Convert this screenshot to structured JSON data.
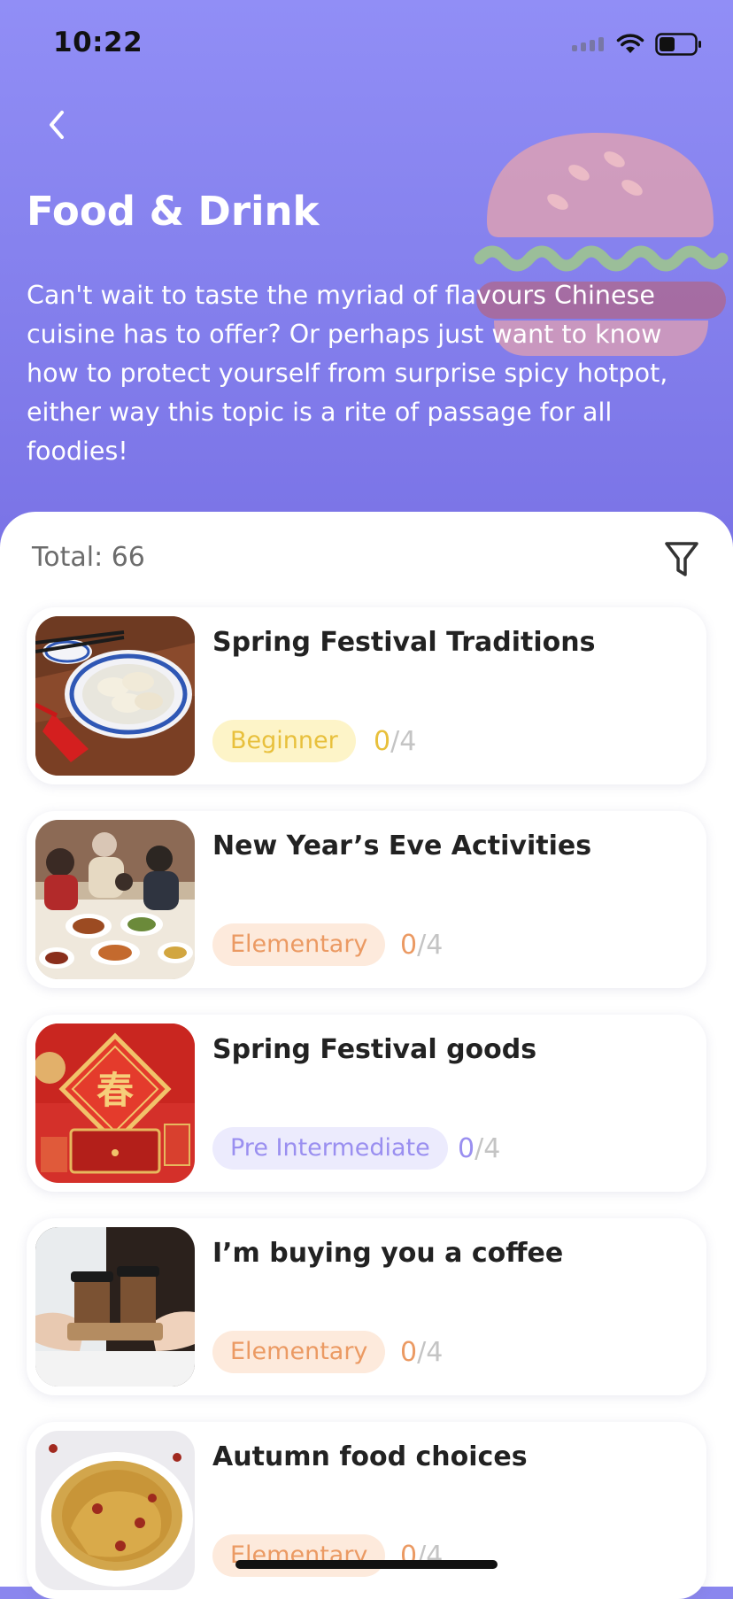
{
  "status_bar": {
    "time": "10:22",
    "signal_icon": "signal-icon",
    "wifi_icon": "wifi-icon",
    "battery_icon": "battery-icon"
  },
  "header": {
    "back_icon": "chevron-left-icon",
    "title": "Food & Drink",
    "description": "Can't wait to taste the myriad of flavours Chinese cuisine has to offer? Or perhaps just want to know how to protect yourself from surprise spicy hotpot, either way this topic is a rite of passage for all foodies!",
    "illustration": "burger-illustration"
  },
  "list": {
    "total_label": "Total: 66",
    "filter_icon": "filter-icon",
    "items": [
      {
        "title": "Spring Festival Traditions",
        "level": "Beginner",
        "done": "0",
        "total": "/4",
        "level_color": "#e8c03c",
        "level_bg": "#fdf4c8",
        "image": "dumplings-photo"
      },
      {
        "title": "New Year’s Eve Activities",
        "level": "Elementary",
        "done": "0",
        "total": "/4",
        "level_color": "#eb9a63",
        "level_bg": "#fdeadc",
        "image": "family-dinner-photo"
      },
      {
        "title": "Spring Festival goods",
        "level": "Pre Intermediate",
        "done": "0",
        "total": "/4",
        "level_color": "#9a8ff0",
        "level_bg": "#ecebfd",
        "image": "spring-festival-gifts-photo"
      },
      {
        "title": "I’m buying you a coffee",
        "level": "Elementary",
        "done": "0",
        "total": "/4",
        "level_color": "#eb9a63",
        "level_bg": "#fdeadc",
        "image": "coffee-cups-photo"
      },
      {
        "title": "Autumn food choices",
        "level": "Elementary",
        "done": "0",
        "total": "/4",
        "level_color": "#eb9a63",
        "level_bg": "#fdeadc",
        "image": "chicken-soup-photo"
      }
    ]
  }
}
